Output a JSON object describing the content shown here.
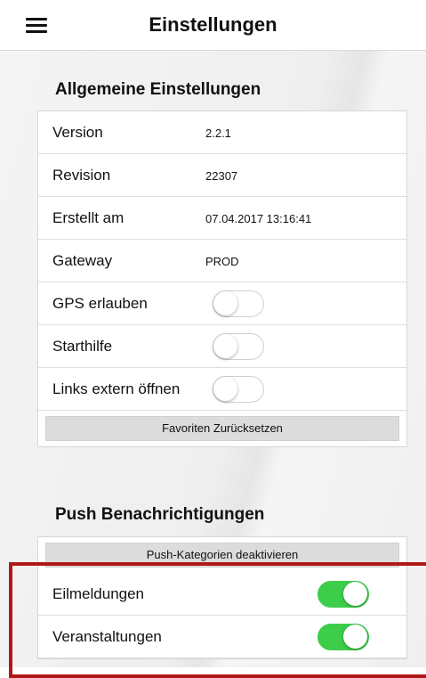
{
  "header": {
    "title": "Einstellungen",
    "menu_icon": "hamburger-menu-icon"
  },
  "general": {
    "title": "Allgemeine Einstellungen",
    "rows": [
      {
        "label": "Version",
        "value": "2.2.1"
      },
      {
        "label": "Revision",
        "value": "22307"
      },
      {
        "label": "Erstellt am",
        "value": "07.04.2017 13:16:41"
      },
      {
        "label": "Gateway",
        "value": "PROD"
      }
    ],
    "toggles": [
      {
        "label": "GPS erlauben",
        "on": false
      },
      {
        "label": "Starthilfe",
        "on": false
      },
      {
        "label": "Links extern öffnen",
        "on": false
      }
    ],
    "reset_favorites_label": "Favoriten Zurücksetzen"
  },
  "push": {
    "title": "Push Benachrichtigungen",
    "deactivate_label": "Push-Kategorien deaktivieren",
    "toggles": [
      {
        "label": "Eilmeldungen",
        "on": true
      },
      {
        "label": "Veranstaltungen",
        "on": true
      }
    ]
  },
  "colors": {
    "toggle_on": "#3ccd4a",
    "highlight": "#b01818"
  }
}
